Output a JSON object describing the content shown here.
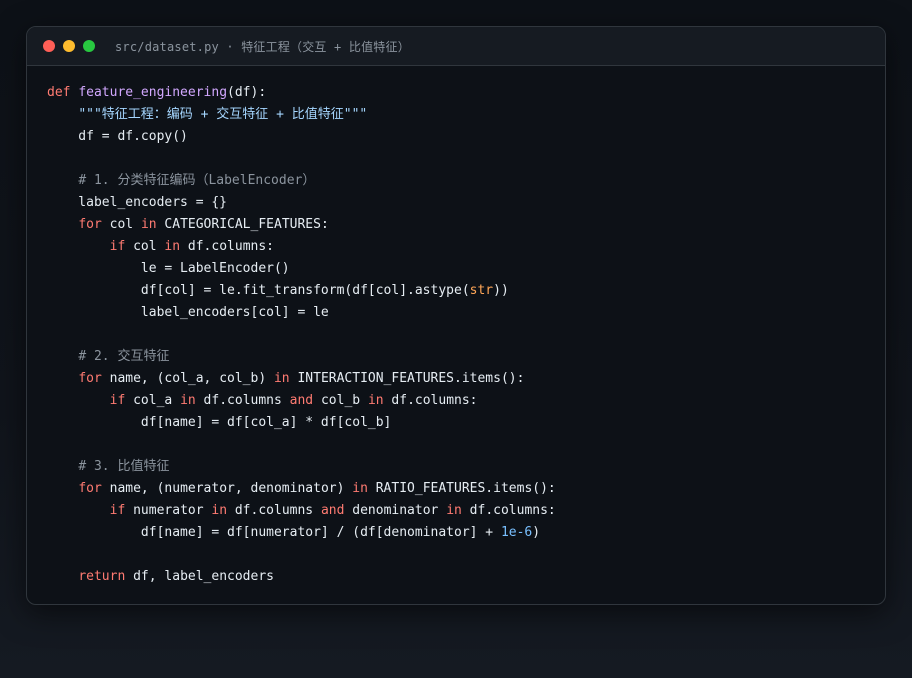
{
  "window": {
    "title": "src/dataset.py · 特征工程（交互 + 比值特征）"
  },
  "code": {
    "lines": [
      [
        {
          "t": "kw",
          "v": "def"
        },
        {
          "t": "",
          "v": " "
        },
        {
          "t": "fn",
          "v": "feature_engineering"
        },
        {
          "t": "",
          "v": "(df):"
        }
      ],
      [
        {
          "t": "",
          "v": "    "
        },
        {
          "t": "str",
          "v": "\"\"\"特征工程：编码 + 交互特征 + 比值特征\"\"\""
        }
      ],
      [
        {
          "t": "",
          "v": "    df = df.copy()"
        }
      ],
      [],
      [
        {
          "t": "",
          "v": "    "
        },
        {
          "t": "cm",
          "v": "# 1. 分类特征编码（LabelEncoder）"
        }
      ],
      [
        {
          "t": "",
          "v": "    label_encoders = {}"
        }
      ],
      [
        {
          "t": "",
          "v": "    "
        },
        {
          "t": "kw",
          "v": "for"
        },
        {
          "t": "",
          "v": " col "
        },
        {
          "t": "kw",
          "v": "in"
        },
        {
          "t": "",
          "v": " CATEGORICAL_FEATURES:"
        }
      ],
      [
        {
          "t": "",
          "v": "        "
        },
        {
          "t": "kw",
          "v": "if"
        },
        {
          "t": "",
          "v": " col "
        },
        {
          "t": "kw",
          "v": "in"
        },
        {
          "t": "",
          "v": " df.columns:"
        }
      ],
      [
        {
          "t": "",
          "v": "            le = LabelEncoder()"
        }
      ],
      [
        {
          "t": "",
          "v": "            df[col] = le.fit_transform(df[col].astype("
        },
        {
          "t": "bi",
          "v": "str"
        },
        {
          "t": "",
          "v": "))"
        }
      ],
      [
        {
          "t": "",
          "v": "            label_encoders[col] = le"
        }
      ],
      [],
      [
        {
          "t": "",
          "v": "    "
        },
        {
          "t": "cm",
          "v": "# 2. 交互特征"
        }
      ],
      [
        {
          "t": "",
          "v": "    "
        },
        {
          "t": "kw",
          "v": "for"
        },
        {
          "t": "",
          "v": " name, (col_a, col_b) "
        },
        {
          "t": "kw",
          "v": "in"
        },
        {
          "t": "",
          "v": " INTERACTION_FEATURES.items():"
        }
      ],
      [
        {
          "t": "",
          "v": "        "
        },
        {
          "t": "kw",
          "v": "if"
        },
        {
          "t": "",
          "v": " col_a "
        },
        {
          "t": "kw",
          "v": "in"
        },
        {
          "t": "",
          "v": " df.columns "
        },
        {
          "t": "kw",
          "v": "and"
        },
        {
          "t": "",
          "v": " col_b "
        },
        {
          "t": "kw",
          "v": "in"
        },
        {
          "t": "",
          "v": " df.columns:"
        }
      ],
      [
        {
          "t": "",
          "v": "            df[name] = df[col_a] * df[col_b]"
        }
      ],
      [],
      [
        {
          "t": "",
          "v": "    "
        },
        {
          "t": "cm",
          "v": "# 3. 比值特征"
        }
      ],
      [
        {
          "t": "",
          "v": "    "
        },
        {
          "t": "kw",
          "v": "for"
        },
        {
          "t": "",
          "v": " name, (numerator, denominator) "
        },
        {
          "t": "kw",
          "v": "in"
        },
        {
          "t": "",
          "v": " RATIO_FEATURES.items():"
        }
      ],
      [
        {
          "t": "",
          "v": "        "
        },
        {
          "t": "kw",
          "v": "if"
        },
        {
          "t": "",
          "v": " numerator "
        },
        {
          "t": "kw",
          "v": "in"
        },
        {
          "t": "",
          "v": " df.columns "
        },
        {
          "t": "kw",
          "v": "and"
        },
        {
          "t": "",
          "v": " denominator "
        },
        {
          "t": "kw",
          "v": "in"
        },
        {
          "t": "",
          "v": " df.columns:"
        }
      ],
      [
        {
          "t": "",
          "v": "            df[name] = df[numerator] / (df[denominator] + "
        },
        {
          "t": "num",
          "v": "1e-6"
        },
        {
          "t": "",
          "v": ")"
        }
      ],
      [],
      [
        {
          "t": "",
          "v": "    "
        },
        {
          "t": "kw",
          "v": "return"
        },
        {
          "t": "",
          "v": " df, label_encoders"
        }
      ]
    ]
  }
}
